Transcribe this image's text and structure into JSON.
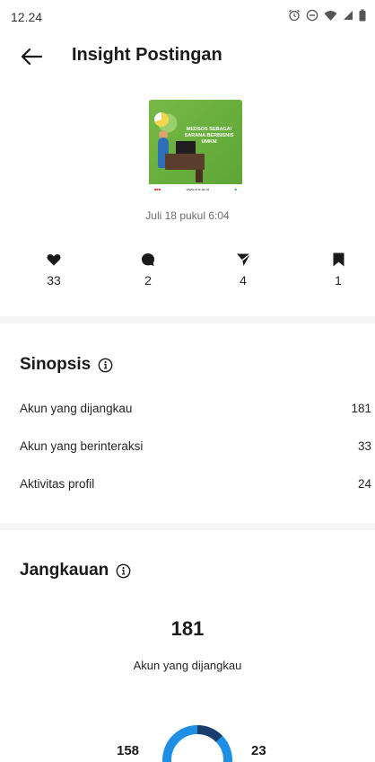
{
  "status_bar": {
    "time": "12.24",
    "icons": [
      "alarm-icon",
      "do-not-disturb-icon",
      "wifi-icon",
      "signal-icon",
      "battery-icon"
    ]
  },
  "header": {
    "title": "Insight Postingan",
    "back_icon": "arrow-left-icon"
  },
  "post": {
    "thumbnail_text": [
      "MEDSOS SEBAGAI",
      "SARANA BERBISNIS",
      "UMKM"
    ],
    "thumbnail_footer": "www.uns.ac.id",
    "date": "Juli 18 pukul 6:04"
  },
  "stats": {
    "likes": "33",
    "comments": "2",
    "shares": "4",
    "saves": "1"
  },
  "sinopsis": {
    "title": "Sinopsis",
    "rows": [
      {
        "label": "Akun yang dijangkau",
        "value": "181"
      },
      {
        "label": "Akun yang berinteraksi",
        "value": "33"
      },
      {
        "label": "Aktivitas profil",
        "value": "24"
      }
    ]
  },
  "jangkauan": {
    "title": "Jangkauan",
    "total": "181",
    "caption": "Akun yang dijangkau",
    "followers": "158",
    "non_followers": "23",
    "followers_fraction": 0.873
  },
  "colors": {
    "accent_blue": "#1f8fe5",
    "dark_blue": "#1b3d6e",
    "divider": "#f5f5f5"
  }
}
